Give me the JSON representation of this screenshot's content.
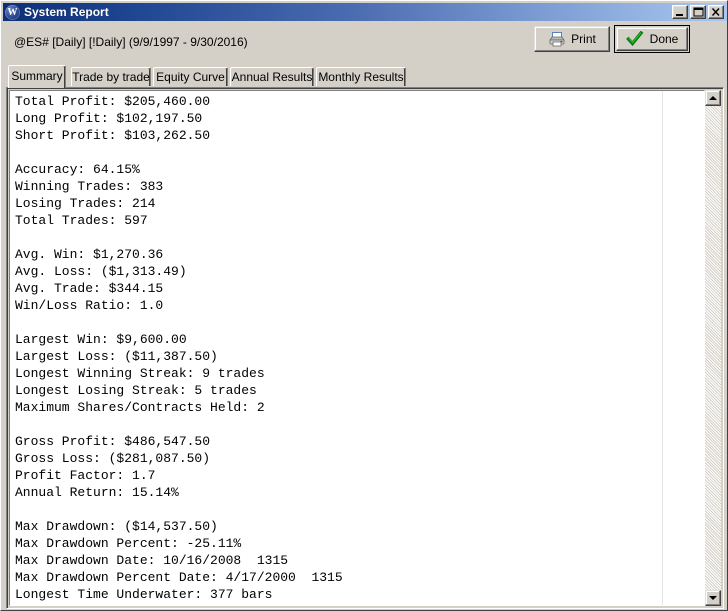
{
  "window": {
    "title": "System Report",
    "icon": "W",
    "controls": [
      {
        "name": "minimize",
        "glyph": "minimize-icon"
      },
      {
        "name": "maximize",
        "glyph": "maximize-icon"
      },
      {
        "name": "close",
        "glyph": "close-icon"
      }
    ]
  },
  "header": {
    "symbol_line": "@ES# [Daily] [!Daily]  (9/9/1997 - 9/30/2016)",
    "print_label": "Print",
    "done_label": "Done"
  },
  "tabs": [
    {
      "label": "Summary",
      "active": true
    },
    {
      "label": "Trade by trade",
      "active": false
    },
    {
      "label": "Equity Curve",
      "active": false
    },
    {
      "label": "Annual Results",
      "active": false
    },
    {
      "label": "Monthly Results",
      "active": false
    }
  ],
  "report": {
    "text": "Total Profit: $205,460.00\nLong Profit: $102,197.50\nShort Profit: $103,262.50\n\nAccuracy: 64.15%\nWinning Trades: 383\nLosing Trades: 214\nTotal Trades: 597\n\nAvg. Win: $1,270.36\nAvg. Loss: ($1,313.49)\nAvg. Trade: $344.15\nWin/Loss Ratio: 1.0\n\nLargest Win: $9,600.00\nLargest Loss: ($11,387.50)\nLongest Winning Streak: 9 trades\nLongest Losing Streak: 5 trades\nMaximum Shares/Contracts Held: 2\n\nGross Profit: $486,547.50\nGross Loss: ($281,087.50)\nProfit Factor: 1.7\nAnnual Return: 15.14%\n\nMax Drawdown: ($14,537.50)\nMax Drawdown Percent: -25.11%\nMax Drawdown Date: 10/16/2008  1315\nMax Drawdown Percent Date: 4/17/2000  1315\nLongest Time Underwater: 377 bars",
    "metrics": [
      {
        "label": "Total Profit",
        "value": "$205,460.00"
      },
      {
        "label": "Long Profit",
        "value": "$102,197.50"
      },
      {
        "label": "Short Profit",
        "value": "$103,262.50"
      },
      {
        "label": "Accuracy",
        "value": "64.15%"
      },
      {
        "label": "Winning Trades",
        "value": "383"
      },
      {
        "label": "Losing Trades",
        "value": "214"
      },
      {
        "label": "Total Trades",
        "value": "597"
      },
      {
        "label": "Avg. Win",
        "value": "$1,270.36"
      },
      {
        "label": "Avg. Loss",
        "value": "($1,313.49)"
      },
      {
        "label": "Avg. Trade",
        "value": "$344.15"
      },
      {
        "label": "Win/Loss Ratio",
        "value": "1.0"
      },
      {
        "label": "Largest Win",
        "value": "$9,600.00"
      },
      {
        "label": "Largest Loss",
        "value": "($11,387.50)"
      },
      {
        "label": "Longest Winning Streak",
        "value": "9 trades"
      },
      {
        "label": "Longest Losing Streak",
        "value": "5 trades"
      },
      {
        "label": "Maximum Shares/Contracts Held",
        "value": "2"
      },
      {
        "label": "Gross Profit",
        "value": "$486,547.50"
      },
      {
        "label": "Gross Loss",
        "value": "($281,087.50)"
      },
      {
        "label": "Profit Factor",
        "value": "1.7"
      },
      {
        "label": "Annual Return",
        "value": "15.14%"
      },
      {
        "label": "Max Drawdown",
        "value": "($14,537.50)"
      },
      {
        "label": "Max Drawdown Percent",
        "value": "-25.11%"
      },
      {
        "label": "Max Drawdown Date",
        "value": "10/16/2008  1315"
      },
      {
        "label": "Max Drawdown Percent Date",
        "value": "4/17/2000  1315"
      },
      {
        "label": "Longest Time Underwater",
        "value": "377 bars"
      }
    ]
  },
  "scrollbar": {
    "up_icon": "scroll-up-arrow-icon",
    "down_icon": "scroll-down-arrow-icon"
  },
  "colors": {
    "title_start": "#0c2f77",
    "title_end": "#a9c8ef",
    "face": "#d4d0c8",
    "check_green": "#18a018"
  }
}
